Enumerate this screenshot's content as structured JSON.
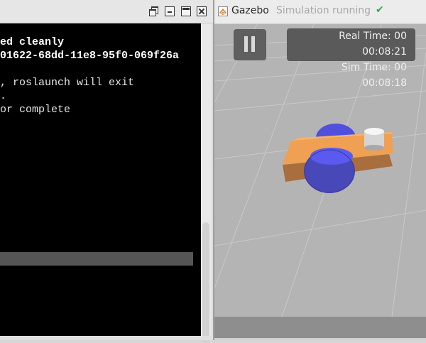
{
  "terminal": {
    "lines": [
      {
        "text": "ed cleanly",
        "bold": true
      },
      {
        "text": "01622-68dd-11e8-95f0-069f26a",
        "bold": true
      },
      {
        "text": "",
        "bold": false
      },
      {
        "text": ", roslaunch will exit",
        "bold": false
      },
      {
        "text": ".",
        "bold": false
      },
      {
        "text": "or complete",
        "bold": false
      }
    ]
  },
  "gazebo": {
    "app_title": "Gazebo",
    "status": "Simulation running",
    "status_color": "#3aa64a",
    "real_time_label": "Real Time: 00",
    "real_time_value": "00:08:21",
    "sim_time_label": "Sim Time: 00",
    "sim_time_value": "00:08:18",
    "robot_body_color": "#f0a052",
    "wheel_color": "#4a4ac8"
  },
  "icons": {
    "window_buttons": [
      "restore-icon",
      "minimize-icon",
      "maximize-icon",
      "close-icon"
    ],
    "gazebo": [
      "gazebo-logo-icon",
      "check-icon",
      "pause-icon"
    ]
  }
}
